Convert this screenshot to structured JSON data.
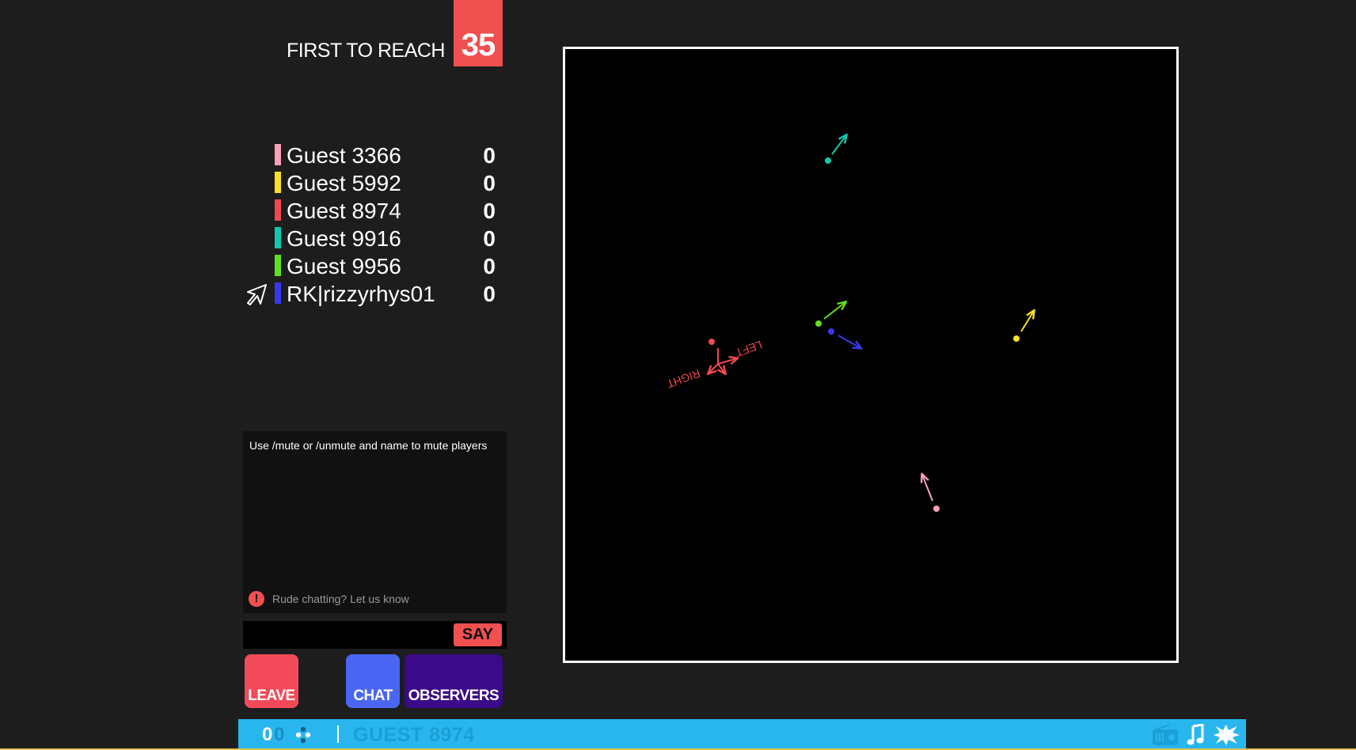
{
  "header": {
    "goal_label": "FIRST TO REACH",
    "goal_value": "35"
  },
  "scoreboard": [
    {
      "name": "Guest 3366",
      "score": "0",
      "color": "#f8a0b8",
      "is_self": false
    },
    {
      "name": "Guest 5992",
      "score": "0",
      "color": "#f8e028",
      "is_self": false
    },
    {
      "name": "Guest 8974",
      "score": "0",
      "color": "#f04850",
      "is_self": false
    },
    {
      "name": "Guest 9916",
      "score": "0",
      "color": "#10c8b0",
      "is_self": false
    },
    {
      "name": "Guest 9956",
      "score": "0",
      "color": "#60e020",
      "is_self": false
    },
    {
      "name": "RK|rizzyrhys01",
      "score": "0",
      "color": "#3838f0",
      "is_self": true
    }
  ],
  "chat": {
    "system_message": "Use /mute or /unmute and name to mute players",
    "report_text": "Rude chatting? Let us know",
    "input_placeholder": "",
    "say_label": "SAY"
  },
  "buttons": {
    "leave": "LEAVE",
    "chat": "CHAT",
    "observers": "OBSERVERS"
  },
  "arena": {
    "control_hint_left": "LEFT",
    "control_hint_right": "RIGHT"
  },
  "bottom_bar": {
    "counter_a": "0",
    "counter_b": "0",
    "username": "GUEST 8974",
    "icons": [
      "players-icon",
      "radio-icon",
      "music-icon",
      "effects-icon"
    ]
  }
}
